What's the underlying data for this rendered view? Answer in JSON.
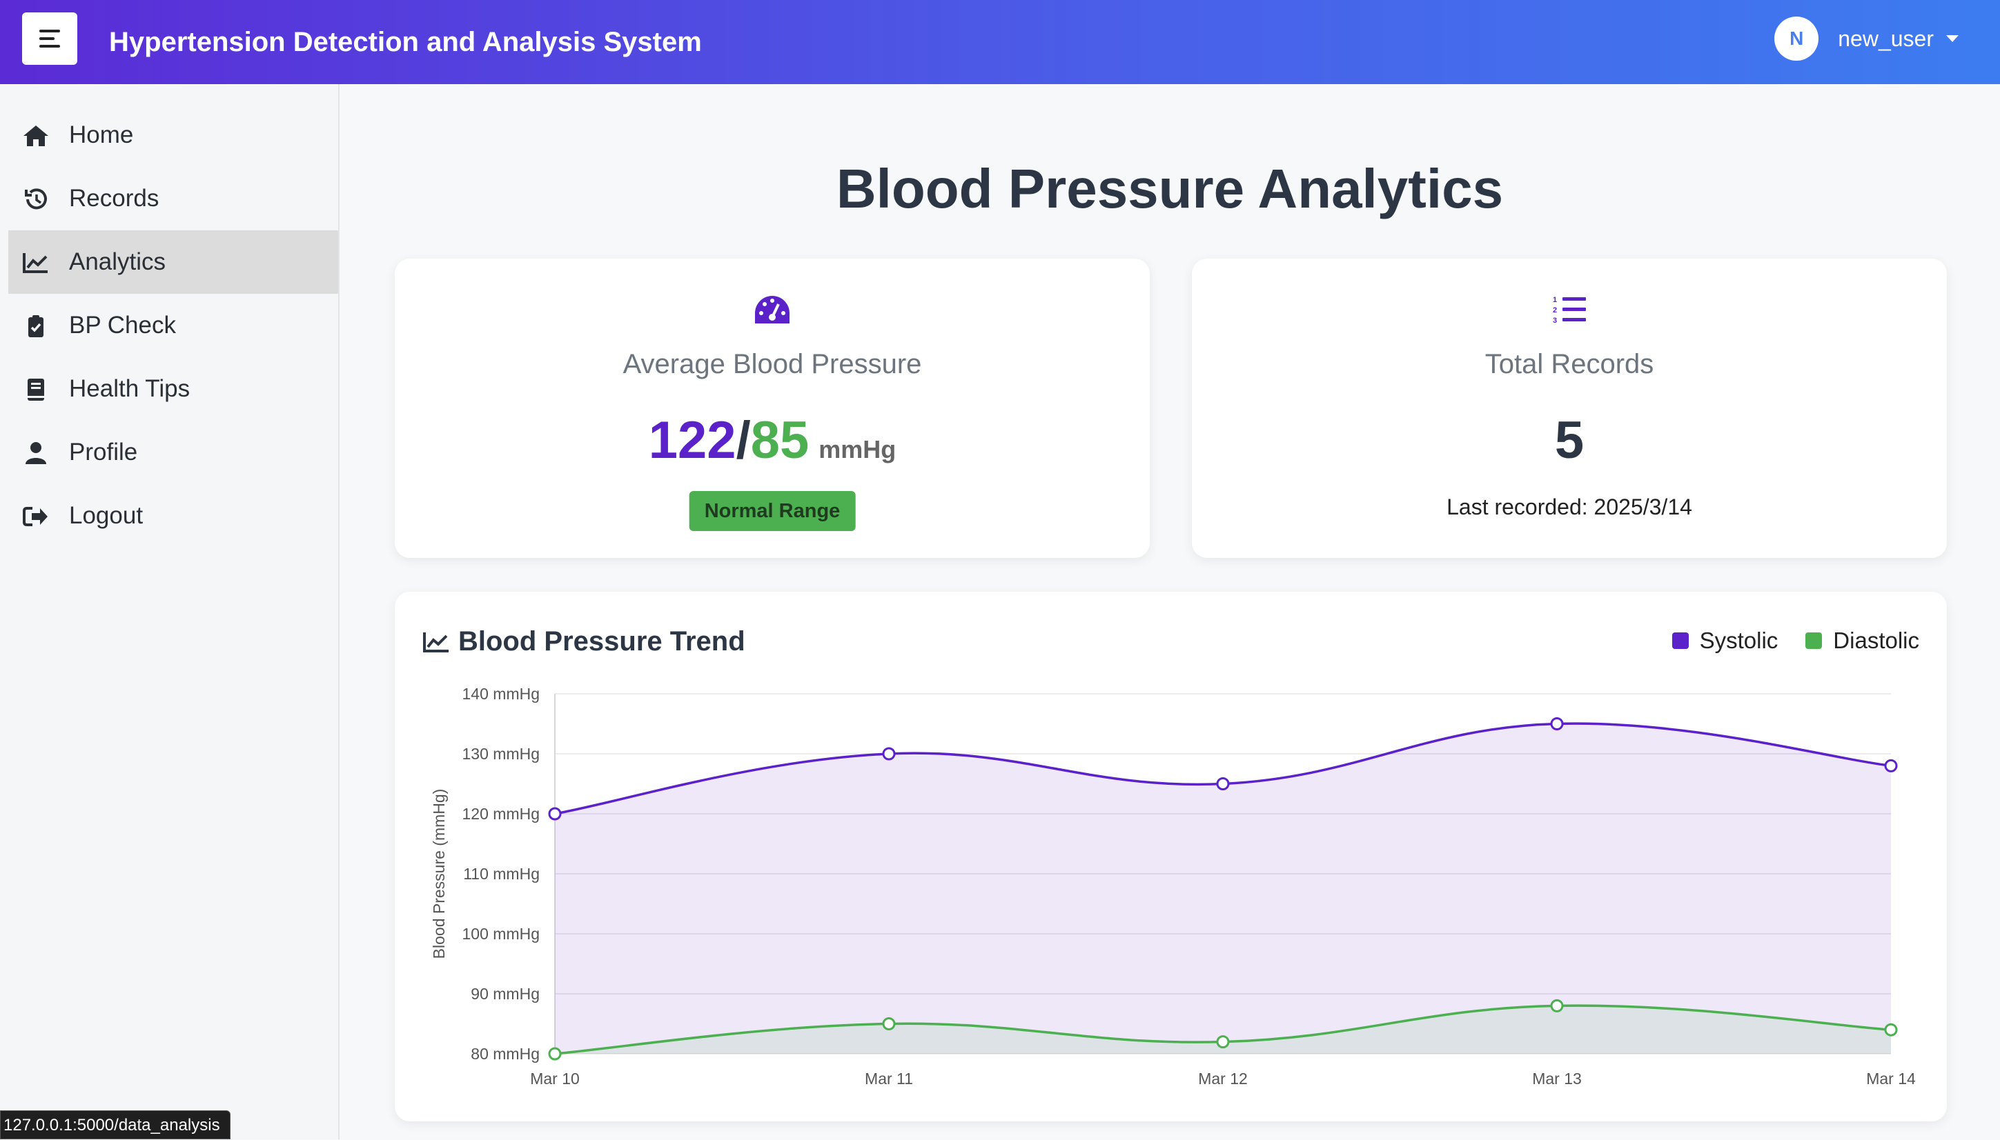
{
  "header": {
    "title": "Hypertension Detection and Analysis System",
    "user_initial": "N",
    "username": "new_user"
  },
  "sidebar": {
    "items": [
      {
        "label": "Home",
        "icon": "home-icon",
        "active": false
      },
      {
        "label": "Records",
        "icon": "history-icon",
        "active": false
      },
      {
        "label": "Analytics",
        "icon": "chart-line-icon",
        "active": true
      },
      {
        "label": "BP Check",
        "icon": "clipboard-check-icon",
        "active": false
      },
      {
        "label": "Health Tips",
        "icon": "book-icon",
        "active": false
      },
      {
        "label": "Profile",
        "icon": "user-icon",
        "active": false
      },
      {
        "label": "Logout",
        "icon": "sign-out-icon",
        "active": false
      }
    ]
  },
  "page": {
    "title": "Blood Pressure Analytics"
  },
  "average_card": {
    "label": "Average Blood Pressure",
    "systolic": "122",
    "separator": "/",
    "diastolic": "85",
    "unit": "mmHg",
    "badge": "Normal Range"
  },
  "total_card": {
    "label": "Total Records",
    "count": "5",
    "last_recorded": "Last recorded: 2025/3/14"
  },
  "trend_card": {
    "title": "Blood Pressure Trend"
  },
  "colors": {
    "systolic": "#5a22c8",
    "diastolic": "#4caf50",
    "header_start": "#5b2bd6",
    "header_end": "#3d7cf0"
  },
  "status_bar": {
    "url": "127.0.0.1:5000/data_analysis"
  },
  "chart_data": {
    "type": "line",
    "categories": [
      "Mar 10",
      "Mar 11",
      "Mar 12",
      "Mar 13",
      "Mar 14"
    ],
    "series": [
      {
        "name": "Systolic",
        "values": [
          120,
          130,
          125,
          135,
          128
        ]
      },
      {
        "name": "Diastolic",
        "values": [
          80,
          85,
          82,
          88,
          84
        ]
      }
    ],
    "ylabel": "Blood Pressure (mmHg)",
    "ylim": [
      80,
      140
    ],
    "yticks": [
      "80 mmHg",
      "90 mmHg",
      "100 mmHg",
      "110 mmHg",
      "120 mmHg",
      "130 mmHg",
      "140 mmHg"
    ],
    "legend": "top-right",
    "grid": true
  }
}
